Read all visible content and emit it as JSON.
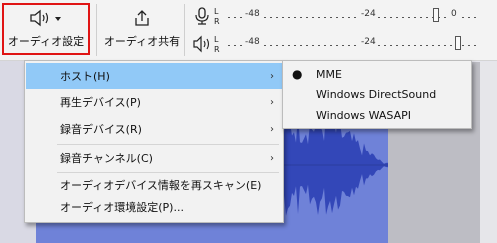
{
  "toolbar": {
    "audio_setup_label": "オーディオ設定",
    "audio_share_label": "オーディオ共有"
  },
  "meters": {
    "recording": {
      "l": "L",
      "r": "R",
      "ticks": [
        "-48",
        "-24",
        "0"
      ]
    },
    "playback": {
      "l": "L",
      "r": "R",
      "ticks": [
        "-48",
        "-24"
      ]
    }
  },
  "menu": {
    "items": [
      {
        "label": "ホスト(H)",
        "submenu": true,
        "highlighted": true
      },
      {
        "label": "再生デバイス(P)",
        "submenu": true
      },
      {
        "label": "録音デバイス(R)",
        "submenu": true
      },
      {
        "label": "録音チャンネル(C)",
        "submenu": true
      },
      {
        "label": "オーディオデバイス情報を再スキャン(E)",
        "submenu": false
      },
      {
        "label": "オーディオ環境設定(P)...",
        "submenu": false
      }
    ],
    "arrow": "›"
  },
  "submenu": {
    "items": [
      {
        "label": "MME",
        "selected": true
      },
      {
        "label": "Windows DirectSound",
        "selected": false
      },
      {
        "label": "Windows WASAPI",
        "selected": false
      }
    ],
    "bullet": "●"
  },
  "colors": {
    "highlight": "#91c9f7",
    "focus_border": "#e01414",
    "waveform": "#3347b8",
    "waveform_bg": "#6f82d8"
  }
}
